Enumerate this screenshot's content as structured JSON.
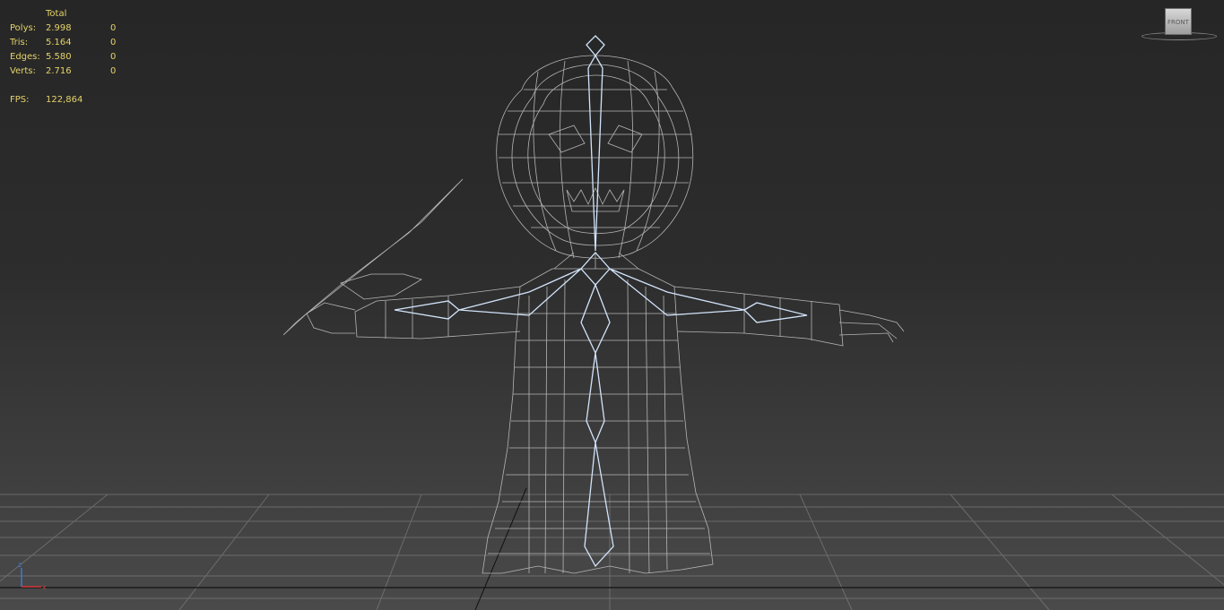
{
  "stats": {
    "header": "Total",
    "rows": [
      {
        "label": "Polys:",
        "value": "2.998",
        "selected": "0"
      },
      {
        "label": "Tris:",
        "value": "5.164",
        "selected": "0"
      },
      {
        "label": "Edges:",
        "value": "5.580",
        "selected": "0"
      },
      {
        "label": "Verts:",
        "value": "2.716",
        "selected": "0"
      }
    ],
    "fps_label": "FPS:",
    "fps_value": "122,864"
  },
  "viewcube": {
    "face": "FRONT"
  },
  "axis_gizmo": {
    "z": "z",
    "x": "x"
  },
  "colors": {
    "stats_text": "#e5d36a",
    "wire": "#b9b9b9",
    "wire_highlight": "#cfe3ff",
    "grid": "#a0a0a0"
  }
}
